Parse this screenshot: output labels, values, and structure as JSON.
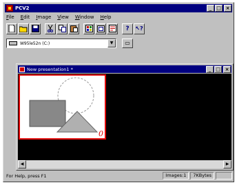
{
  "app": {
    "title": "PCV2"
  },
  "window_buttons": {
    "minimize": "_",
    "maximize": "□",
    "close": "×"
  },
  "menu": [
    {
      "underline": "F",
      "rest": "ile"
    },
    {
      "underline": "E",
      "rest": "dit"
    },
    {
      "underline": "I",
      "rest": "mage"
    },
    {
      "underline": "V",
      "rest": "iew"
    },
    {
      "underline": "W",
      "rest": "indow"
    },
    {
      "underline": "H",
      "rest": "elp"
    }
  ],
  "toolbar": {
    "new_icon": "new-document-icon",
    "open_icon": "open-folder-icon",
    "save_icon": "save-disk-icon",
    "cut_icon": "scissors-icon",
    "copy_icon": "copy-icon",
    "paste_icon": "paste-icon",
    "help_icon": "question-mark-icon",
    "context_help_icon": "context-help-icon"
  },
  "drive": {
    "value": "W95le52n (C:)"
  },
  "child_window": {
    "title": "New presentation1 *"
  },
  "thumbnail": {
    "index": "0"
  },
  "status": {
    "help_text": "For Help, press F1",
    "images": "Images:1",
    "size": "7KBytes"
  }
}
